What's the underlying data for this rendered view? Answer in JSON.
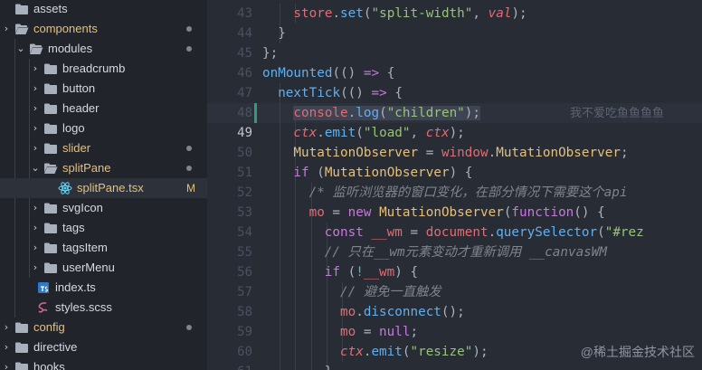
{
  "explorer": {
    "rows": [
      {
        "depth": 0,
        "chev": "",
        "icon": "folder-icon",
        "label": "assets",
        "color": "plain",
        "mark": "",
        "badge": ""
      },
      {
        "depth": 0,
        "chev": "›",
        "icon": "folder-open-icon",
        "label": "components",
        "color": "modified",
        "mark": "dot",
        "badge": ""
      },
      {
        "depth": 1,
        "chev": "⌄",
        "icon": "folder-open-icon",
        "label": "modules",
        "color": "plain",
        "mark": "dot",
        "badge": ""
      },
      {
        "depth": 2,
        "chev": "›",
        "icon": "folder-icon",
        "label": "breadcrumb",
        "color": "plain",
        "mark": "",
        "badge": ""
      },
      {
        "depth": 2,
        "chev": "›",
        "icon": "folder-icon",
        "label": "button",
        "color": "plain",
        "mark": "",
        "badge": ""
      },
      {
        "depth": 2,
        "chev": "›",
        "icon": "folder-icon",
        "label": "header",
        "color": "plain",
        "mark": "",
        "badge": ""
      },
      {
        "depth": 2,
        "chev": "›",
        "icon": "folder-icon",
        "label": "logo",
        "color": "plain",
        "mark": "",
        "badge": ""
      },
      {
        "depth": 2,
        "chev": "›",
        "icon": "folder-icon",
        "label": "slider",
        "color": "modified",
        "mark": "dot",
        "badge": ""
      },
      {
        "depth": 2,
        "chev": "⌄",
        "icon": "folder-open-icon",
        "label": "splitPane",
        "color": "modified",
        "mark": "dot",
        "badge": ""
      },
      {
        "depth": 3,
        "chev": "",
        "icon": "react-icon",
        "label": "splitPane.tsx",
        "color": "modified",
        "mark": "badge",
        "badge": "M",
        "selected": true
      },
      {
        "depth": 2,
        "chev": "›",
        "icon": "folder-icon",
        "label": "svgIcon",
        "color": "plain",
        "mark": "",
        "badge": ""
      },
      {
        "depth": 2,
        "chev": "›",
        "icon": "folder-icon",
        "label": "tags",
        "color": "plain",
        "mark": "",
        "badge": ""
      },
      {
        "depth": 2,
        "chev": "›",
        "icon": "folder-icon",
        "label": "tagsItem",
        "color": "plain",
        "mark": "",
        "badge": ""
      },
      {
        "depth": 2,
        "chev": "›",
        "icon": "folder-icon",
        "label": "userMenu",
        "color": "plain",
        "mark": "",
        "badge": ""
      },
      {
        "depth": 1.5,
        "chev": "",
        "icon": "typescript-icon",
        "label": "index.ts",
        "color": "plain",
        "mark": "",
        "badge": ""
      },
      {
        "depth": 1.5,
        "chev": "",
        "icon": "sass-icon",
        "label": "styles.scss",
        "color": "plain",
        "mark": "",
        "badge": ""
      },
      {
        "depth": 0,
        "chev": "›",
        "icon": "folder-icon",
        "label": "config",
        "color": "modified",
        "mark": "dot",
        "badge": ""
      },
      {
        "depth": 0,
        "chev": "›",
        "icon": "folder-icon",
        "label": "directive",
        "color": "plain",
        "mark": "",
        "badge": ""
      },
      {
        "depth": 0,
        "chev": "›",
        "icon": "folder-icon",
        "label": "hooks",
        "color": "plain",
        "mark": "",
        "badge": ""
      }
    ]
  },
  "colors": {
    "modified": "#e5c07b",
    "plain": "#d7dae0",
    "folder": "#a8b0bd",
    "react": "#61dafb",
    "typescript": "#3178c6",
    "sass": "#cd6799",
    "gitAdded": "#2f9d77"
  },
  "editor": {
    "first_line": 43,
    "active_line": 49,
    "current_line": 48,
    "modified_line": 48,
    "blame_text": "我不爱吃鱼鱼鱼鱼",
    "watermark": "@稀土掘金技术社区",
    "lines": [
      {
        "indent": 3,
        "tokens": [
          [
            "var",
            "store"
          ],
          [
            "pl",
            "."
          ],
          [
            "fn",
            "set"
          ],
          [
            "pl",
            "("
          ],
          [
            "str",
            "\"split-width\""
          ],
          [
            "pl",
            ", "
          ],
          [
            "it",
            "val"
          ],
          [
            "pl",
            ");"
          ]
        ]
      },
      {
        "indent": 2,
        "tokens": [
          [
            "pl",
            "}"
          ]
        ]
      },
      {
        "indent": 1,
        "tokens": [
          [
            "pl",
            "};"
          ]
        ]
      },
      {
        "indent": 1,
        "tokens": [
          [
            "fn",
            "onMounted"
          ],
          [
            "pl",
            "(() "
          ],
          [
            "kw",
            "=>"
          ],
          [
            "pl",
            " {"
          ]
        ]
      },
      {
        "indent": 2,
        "tokens": [
          [
            "fn",
            "nextTick"
          ],
          [
            "pl",
            "(() "
          ],
          [
            "kw",
            "=>"
          ],
          [
            "pl",
            " {"
          ]
        ]
      },
      {
        "indent": 3,
        "tokens": [
          [
            "var",
            "console"
          ],
          [
            "pl",
            "."
          ],
          [
            "fn",
            "log"
          ],
          [
            "pl",
            "("
          ],
          [
            "str",
            "\"children\""
          ],
          [
            "pl",
            ");"
          ]
        ]
      },
      {
        "indent": 3,
        "tokens": [
          [
            "it",
            "ctx"
          ],
          [
            "pl",
            "."
          ],
          [
            "fn",
            "emit"
          ],
          [
            "pl",
            "("
          ],
          [
            "str",
            "\"load\""
          ],
          [
            "pl",
            ", "
          ],
          [
            "it",
            "ctx"
          ],
          [
            "pl",
            ");"
          ]
        ]
      },
      {
        "indent": 3,
        "tokens": [
          [
            "cls",
            "MutationObserver"
          ],
          [
            "pl",
            " = "
          ],
          [
            "var",
            "window"
          ],
          [
            "pl",
            "."
          ],
          [
            "cls",
            "MutationObserver"
          ],
          [
            "pl",
            ";"
          ]
        ]
      },
      {
        "indent": 3,
        "tokens": [
          [
            "kw",
            "if"
          ],
          [
            "pl",
            " ("
          ],
          [
            "cls",
            "MutationObserver"
          ],
          [
            "pl",
            ") {"
          ]
        ]
      },
      {
        "indent": 4,
        "tokens": [
          [
            "cm",
            "/* 监听浏览器的窗口变化，在部分情况下需要这个api"
          ]
        ]
      },
      {
        "indent": 4,
        "tokens": [
          [
            "var",
            "mo"
          ],
          [
            "pl",
            " = "
          ],
          [
            "kw",
            "new"
          ],
          [
            "pl",
            " "
          ],
          [
            "cls",
            "MutationObserver"
          ],
          [
            "pl",
            "("
          ],
          [
            "kw",
            "function"
          ],
          [
            "pl",
            "() {"
          ]
        ]
      },
      {
        "indent": 5,
        "tokens": [
          [
            "kw",
            "const"
          ],
          [
            "pl",
            " "
          ],
          [
            "var",
            "__wm"
          ],
          [
            "pl",
            " = "
          ],
          [
            "var",
            "document"
          ],
          [
            "pl",
            "."
          ],
          [
            "fn",
            "querySelector"
          ],
          [
            "pl",
            "("
          ],
          [
            "str",
            "\"#rez"
          ]
        ]
      },
      {
        "indent": 5,
        "tokens": [
          [
            "cm",
            "// 只在__wm元素变动才重新调用 __canvasWM"
          ]
        ]
      },
      {
        "indent": 5,
        "tokens": [
          [
            "kw",
            "if"
          ],
          [
            "pl",
            " ("
          ],
          [
            "op",
            "!"
          ],
          [
            "var",
            "__wm"
          ],
          [
            "pl",
            ") {"
          ]
        ]
      },
      {
        "indent": 6,
        "tokens": [
          [
            "cm",
            "// 避免一直触发"
          ]
        ]
      },
      {
        "indent": 6,
        "tokens": [
          [
            "var",
            "mo"
          ],
          [
            "pl",
            "."
          ],
          [
            "fn",
            "disconnect"
          ],
          [
            "pl",
            "();"
          ]
        ]
      },
      {
        "indent": 6,
        "tokens": [
          [
            "var",
            "mo"
          ],
          [
            "pl",
            " = "
          ],
          [
            "kw",
            "null"
          ],
          [
            "pl",
            ";"
          ]
        ]
      },
      {
        "indent": 6,
        "tokens": [
          [
            "it",
            "ctx"
          ],
          [
            "pl",
            "."
          ],
          [
            "fn",
            "emit"
          ],
          [
            "pl",
            "("
          ],
          [
            "str",
            "\"resize\""
          ],
          [
            "pl",
            ");"
          ]
        ]
      },
      {
        "indent": 5,
        "tokens": [
          [
            "pl",
            "}"
          ]
        ]
      }
    ]
  }
}
